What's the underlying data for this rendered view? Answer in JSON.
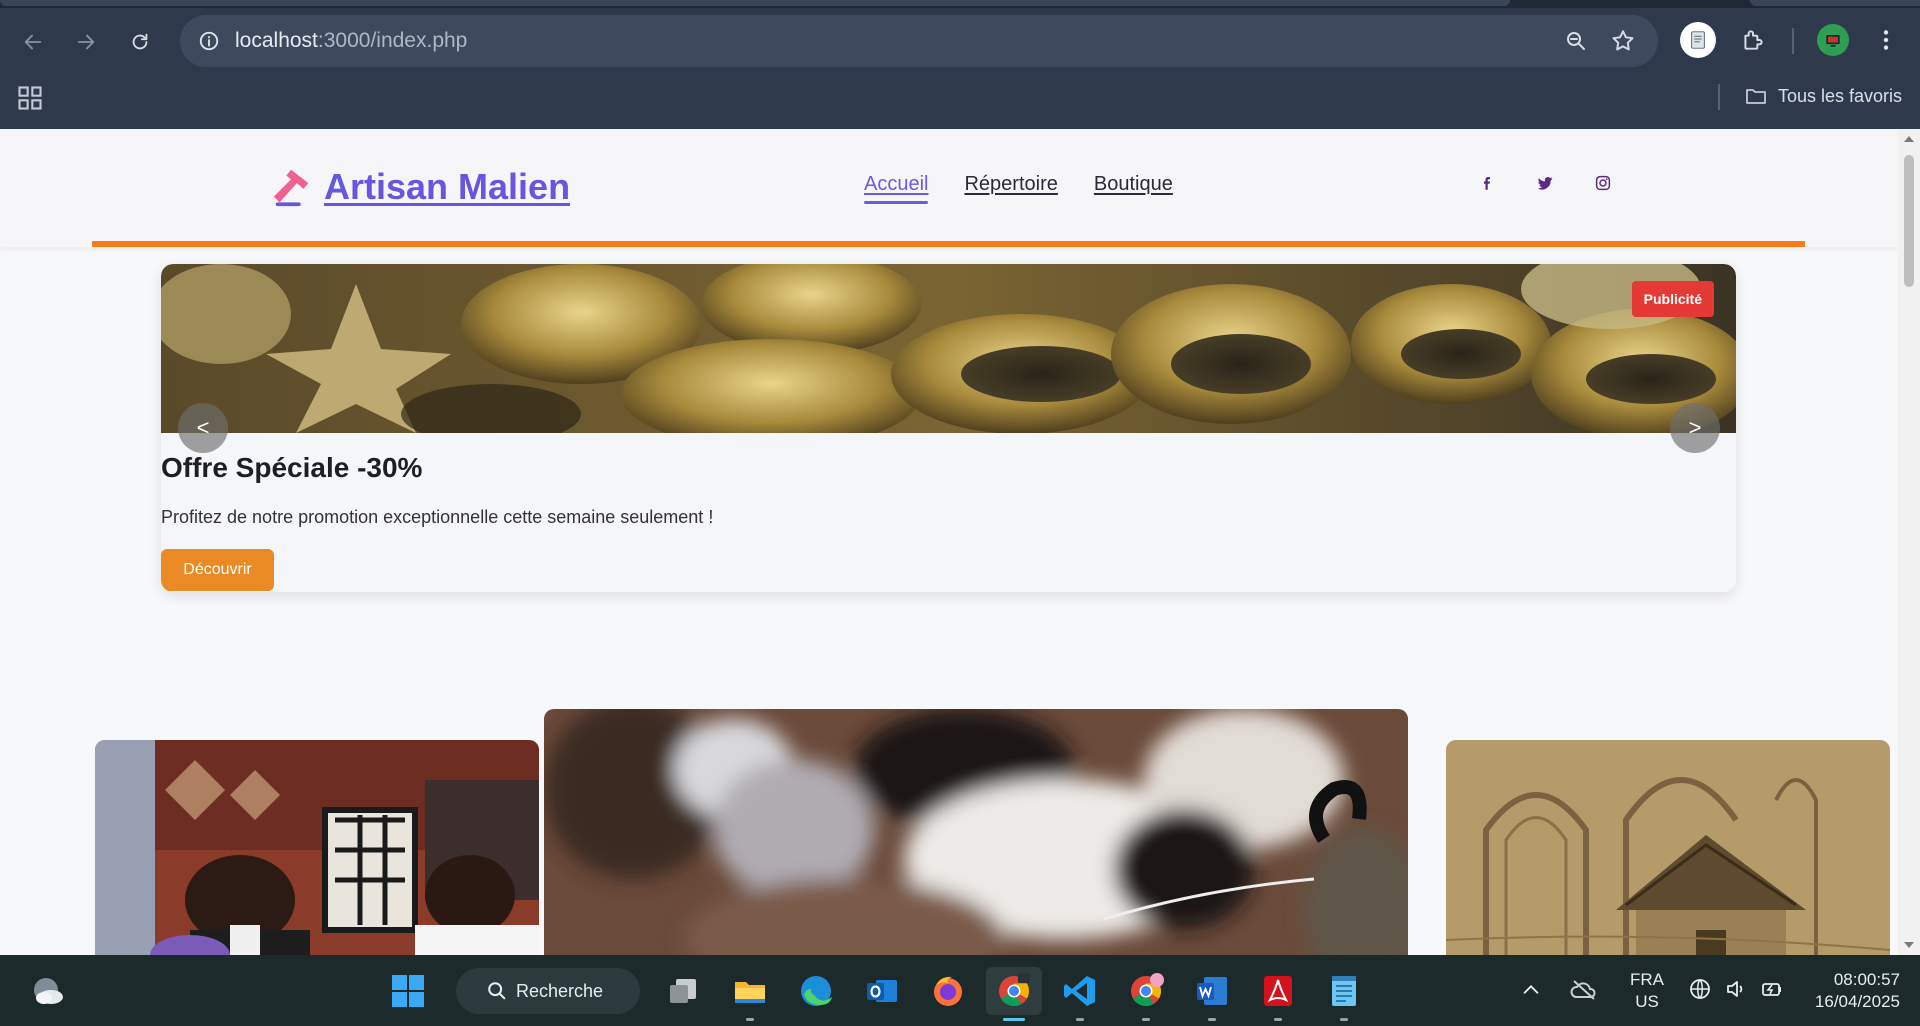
{
  "browser": {
    "url_host": "localhost",
    "url_path": ":3000/index.php",
    "bookmarks_label": "Tous les favoris"
  },
  "site": {
    "logo_text": "Artisan Malien",
    "nav": [
      {
        "label": "Accueil",
        "active": true
      },
      {
        "label": "Répertoire",
        "active": false
      },
      {
        "label": "Boutique",
        "active": false
      }
    ],
    "socials": [
      "facebook-icon",
      "twitter-icon",
      "instagram-icon"
    ],
    "accent_color": "#f57c16",
    "brand_color": "#6656e0"
  },
  "ad": {
    "badge": "Publicité",
    "title": "Offre Spéciale -30%",
    "description": "Profitez de notre promotion exceptionnelle cette semaine seulement !",
    "cta": "Découvrir",
    "prev": "<",
    "next": ">"
  },
  "taskbar": {
    "search_label": "Recherche",
    "lang_line1": "FRA",
    "lang_line2": "US",
    "time": "08:00:57",
    "date": "16/04/2025"
  }
}
